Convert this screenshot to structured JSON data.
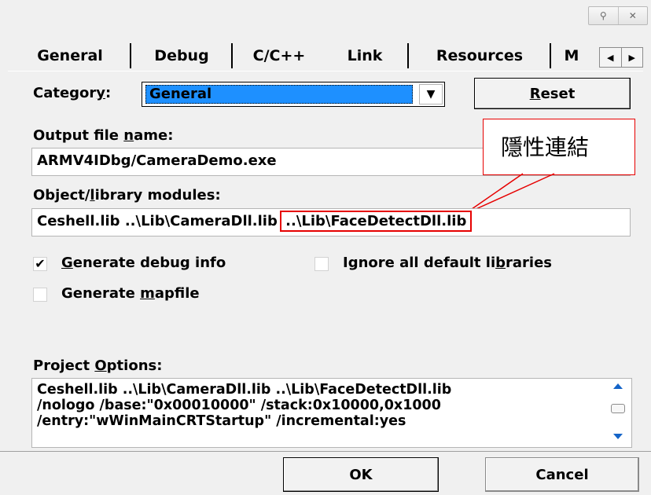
{
  "title_buttons": [
    "⚲",
    "✕"
  ],
  "tabs": [
    "General",
    "Debug",
    "C/C++",
    "Link",
    "Resources",
    "M"
  ],
  "category": {
    "label_pre": "Categor",
    "label_key": "y",
    "label_post": ":",
    "value": "General",
    "reset_key": "R",
    "reset_post": "eset"
  },
  "output": {
    "label_pre": "Output file ",
    "label_key": "n",
    "label_post": "ame:",
    "value": "ARMV4IDbg/CameraDemo.exe"
  },
  "annotation": {
    "text": "隱性連結",
    "color": "#e60000"
  },
  "modules": {
    "label_pre": "Object/",
    "label_key": "l",
    "label_post": "ibrary modules:",
    "value_start": "Ceshell.lib ..\\Lib\\CameraDll.lib ",
    "value_highlight": "..\\Lib\\FaceDetectDll.lib"
  },
  "checkboxes": {
    "debug": {
      "key": "G",
      "post": "enerate debug info",
      "checked": true,
      "mark": "✔"
    },
    "ignore": {
      "pre": "Ignore all default li",
      "key": "b",
      "post": "raries",
      "checked": false
    },
    "mapfile": {
      "pre": "Generate ",
      "key": "m",
      "post": "apfile",
      "checked": false
    }
  },
  "project": {
    "label_pre": "Project ",
    "label_key": "O",
    "label_post": "ptions:",
    "lines": [
      "Ceshell.lib ..\\Lib\\CameraDll.lib ..\\Lib\\FaceDetectDll.lib",
      "/nologo /base:\"0x00010000\" /stack:0x10000,0x1000",
      "/entry:\"wWinMainCRTStartup\" /incremental:yes"
    ]
  },
  "buttons": {
    "ok": "OK",
    "cancel": "Cancel"
  },
  "colors": {
    "selection": "#1e90ff",
    "selection_text": "#000000",
    "scroll_arrow": "#1464c8"
  }
}
